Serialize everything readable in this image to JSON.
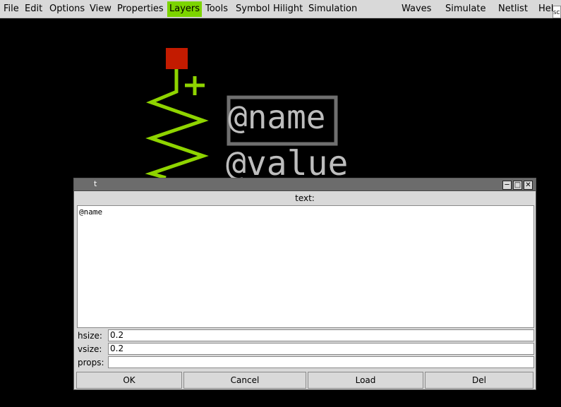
{
  "menubar": {
    "items": [
      "File",
      "Edit",
      "Options",
      "View",
      "Properties",
      "Layers",
      "Tools",
      "Symbol",
      "Hilight",
      "Simulation",
      "Waves",
      "Simulate",
      "Netlist",
      "Help"
    ],
    "active_item": "Layers",
    "sim_indicator": "SC"
  },
  "canvas": {
    "symbol_name_text": "@name",
    "symbol_value_text": "@value",
    "colors": {
      "wire": "#8fd400",
      "pin": "#c31b00",
      "text": "#bdbdbd",
      "selection": "#6f6f6f",
      "background": "#000000"
    }
  },
  "dialog": {
    "title": "t",
    "text_label": "text:",
    "text_value": "@name",
    "fields": {
      "hsize": {
        "label": "hsize:",
        "value": "0.2"
      },
      "vsize": {
        "label": "vsize:",
        "value": "0.2"
      },
      "props": {
        "label": "props:",
        "value": ""
      }
    },
    "buttons": {
      "ok": "OK",
      "cancel": "Cancel",
      "load": "Load",
      "del": "Del"
    },
    "window_controls": [
      "minimize-icon",
      "maximize-icon",
      "close-icon"
    ]
  },
  "colors": {
    "menu_active": "#7cd400",
    "menubar_bg": "#d9d9d9"
  }
}
